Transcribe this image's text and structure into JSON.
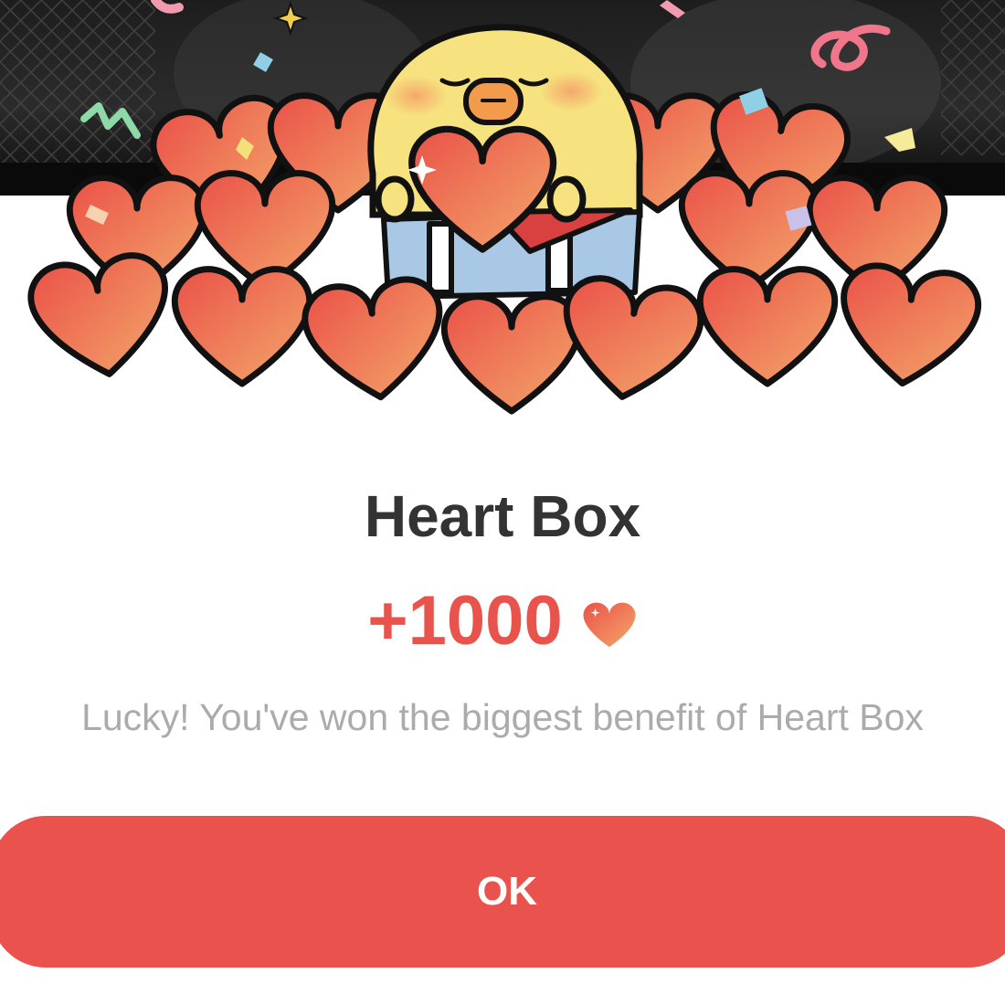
{
  "dialog": {
    "title": "Heart Box",
    "reward_amount": "+1000",
    "reward_icon": "heart-icon",
    "message": "Lucky! You've won the biggest benefit of Heart Box",
    "ok_label": "OK"
  },
  "colors": {
    "accent": "#ea534d",
    "reward_text": "#e8544c",
    "title_text": "#333333",
    "message_text": "#ababab",
    "heart_gradient_start": "#f3a86b",
    "heart_gradient_end": "#ea5148",
    "character_yellow": "#f6e27e"
  }
}
